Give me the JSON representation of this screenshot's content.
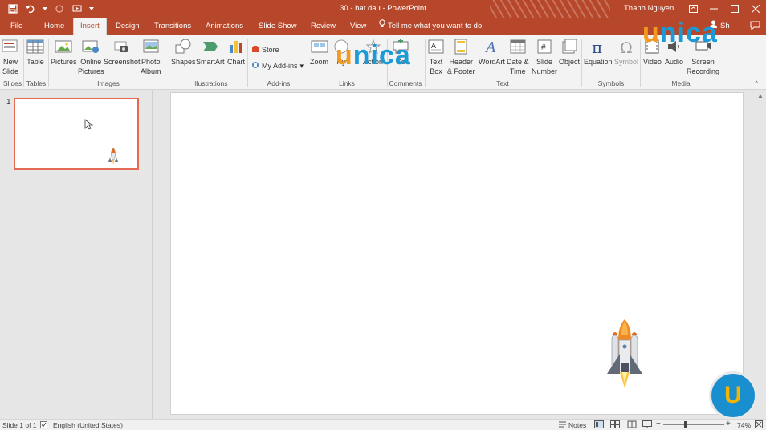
{
  "titlebar": {
    "title": "30 - bat dau  -  PowerPoint",
    "user": "Thanh Nguyen"
  },
  "tabs": [
    {
      "label": "File"
    },
    {
      "label": "Home"
    },
    {
      "label": "Insert"
    },
    {
      "label": "Design"
    },
    {
      "label": "Transitions"
    },
    {
      "label": "Animations"
    },
    {
      "label": "Slide Show"
    },
    {
      "label": "Review"
    },
    {
      "label": "View"
    }
  ],
  "tell_me": "Tell me what you want to do",
  "share_label": "Sh",
  "ribbon": {
    "new_slide": "New\nSlide",
    "table": "Table",
    "pictures": "Pictures",
    "online_pictures": "Online\nPictures",
    "screenshot": "Screenshot",
    "photo_album": "Photo\nAlbum",
    "shapes": "Shapes",
    "smartart": "SmartArt",
    "chart": "Chart",
    "store": "Store",
    "my_addins": "My Add-ins",
    "zoom": "Zoom",
    "hyperlink": "Hy",
    "action": "Action",
    "comment": "Co",
    "text_box": "Text\nBox",
    "header_footer": "Header\n& Footer",
    "wordart": "WordArt",
    "date_time": "Date &\nTime",
    "slide_number": "Slide\nNumber",
    "object": "Object",
    "equation": "Equation",
    "symbol": "Symbol",
    "video": "Video",
    "audio": "Audio",
    "screen_recording": "Screen\nRecording",
    "groups": {
      "slides": "Slides",
      "tables": "Tables",
      "images": "Images",
      "illustrations": "Illustrations",
      "addins": "Add-ins",
      "links": "Links",
      "comments": "Comments",
      "text": "Text",
      "symbols": "Symbols",
      "media": "Media"
    }
  },
  "watermark": {
    "u": "u",
    "rest": "nica"
  },
  "thumbs": {
    "slide_number": "1"
  },
  "badge": {
    "letter": "U"
  },
  "status": {
    "slide_info": "Slide 1 of 1",
    "language": "English (United States)",
    "notes": "Notes",
    "zoom": "74%"
  },
  "colors": {
    "accent": "#b7472a",
    "thumb_border": "#e56a52",
    "unica_orange": "#f39a1e",
    "unica_blue": "#1a9ad6"
  }
}
